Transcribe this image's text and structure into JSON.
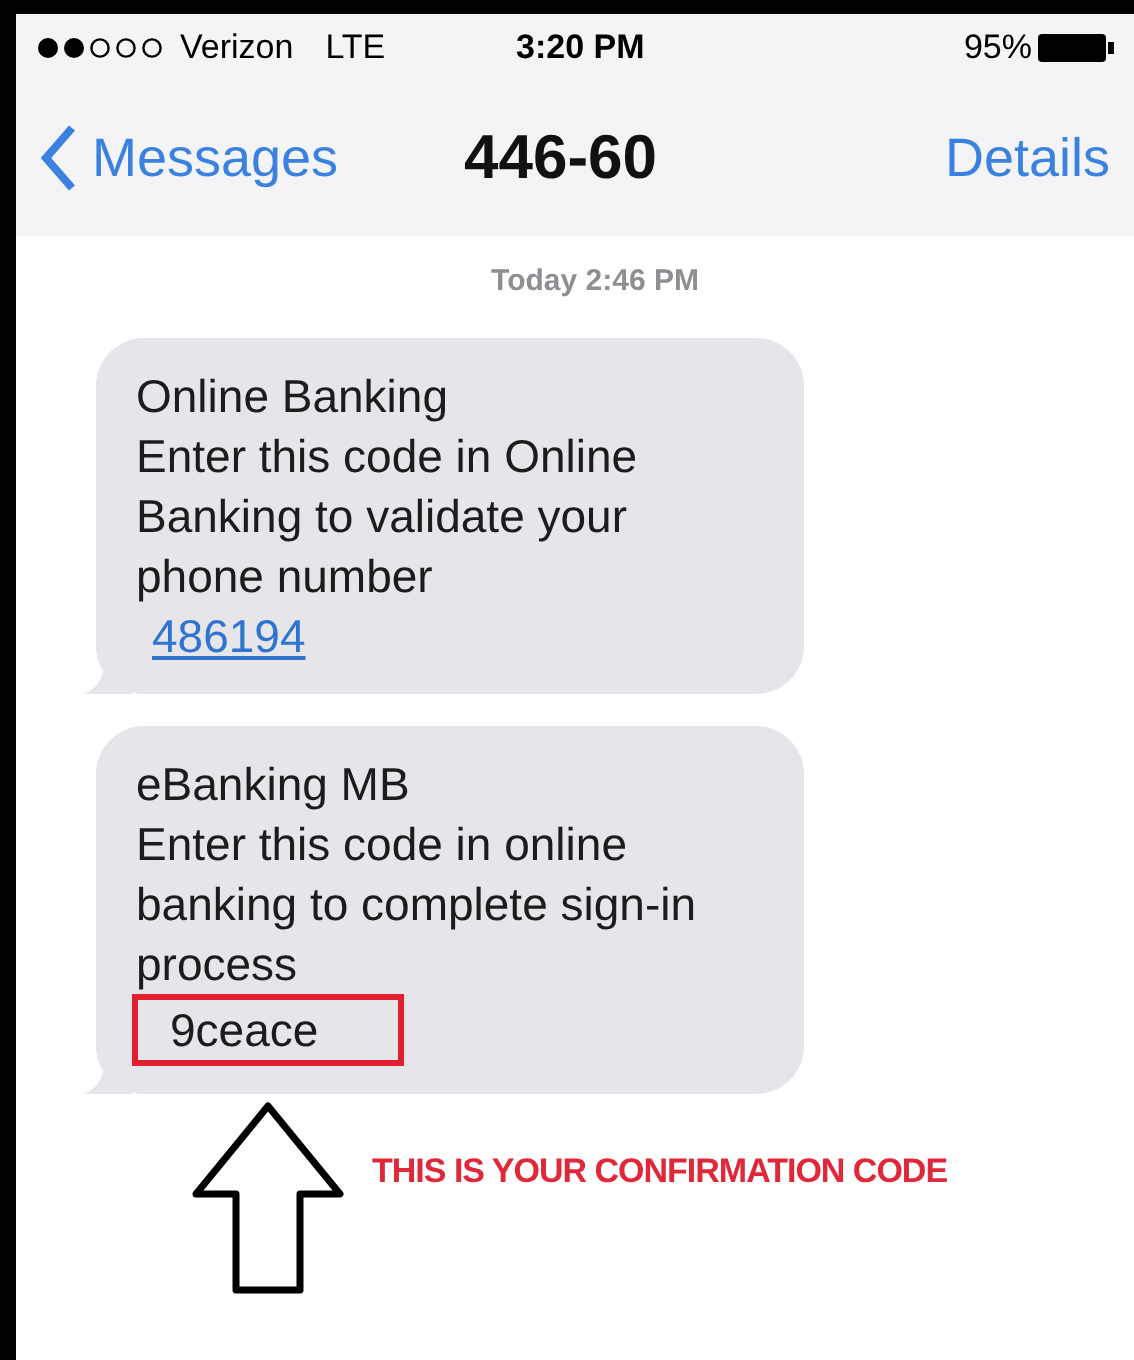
{
  "status_bar": {
    "carrier": "Verizon",
    "network": "LTE",
    "time": "3:20 PM",
    "battery": "95%"
  },
  "nav_bar": {
    "back": "Messages",
    "title": "446-60",
    "action": "Details"
  },
  "timestamp": "Today 2:46 PM",
  "messages": [
    {
      "sender": "Online Banking",
      "body": "Enter this code in Online Banking to validate your phone number",
      "code": "486194",
      "kind": "link"
    },
    {
      "sender": "eBanking MB",
      "body": "Enter this code in online banking to complete sign-in process",
      "code": "9ceace",
      "kind": "highlighted"
    }
  ],
  "annotation": "THIS IS YOUR CONFIRMATION CODE"
}
